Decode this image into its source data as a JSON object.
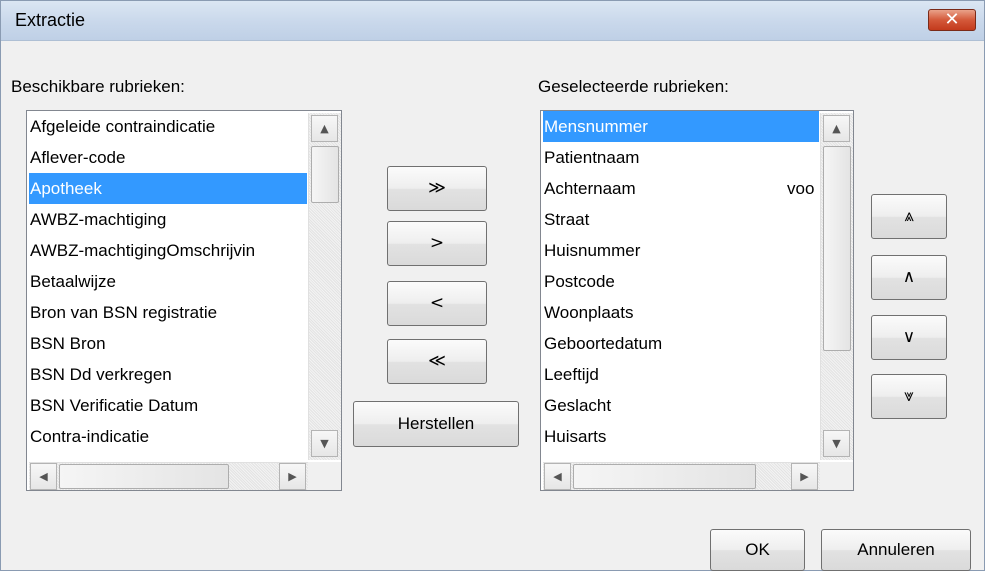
{
  "window": {
    "title": "Extractie",
    "close_glyph": "✕"
  },
  "available": {
    "label": "Beschikbare rubrieken:",
    "items": [
      {
        "label": "Afgeleide contraindicatie"
      },
      {
        "label": "Aflever-code"
      },
      {
        "label": "Apotheek",
        "selected": true
      },
      {
        "label": "AWBZ-machtiging"
      },
      {
        "label": "AWBZ-machtigingOmschrijvin"
      },
      {
        "label": "Betaalwijze"
      },
      {
        "label": "Bron van BSN registratie"
      },
      {
        "label": "BSN Bron"
      },
      {
        "label": "BSN Dd verkregen"
      },
      {
        "label": "BSN Verificatie Datum"
      },
      {
        "label": "Contra-indicatie"
      }
    ]
  },
  "selected": {
    "label": "Geselecteerde rubrieken:",
    "items": [
      {
        "label": "Mensnummer",
        "selected": true
      },
      {
        "label": "Patientnaam"
      },
      {
        "label": "Achternaam",
        "extra": "voo"
      },
      {
        "label": "Straat"
      },
      {
        "label": "Huisnummer"
      },
      {
        "label": "Postcode"
      },
      {
        "label": "Woonplaats"
      },
      {
        "label": "Geboortedatum"
      },
      {
        "label": "Leeftijd"
      },
      {
        "label": "Geslacht"
      },
      {
        "label": "Huisarts"
      }
    ]
  },
  "transfer": {
    "add_all": "≫",
    "add": ">",
    "remove": "<",
    "remove_all": "≪",
    "reset": "Herstellen"
  },
  "order": {
    "top": "⩓",
    "up": "∧",
    "down": "∨",
    "bottom": "⩔"
  },
  "scroll_glyphs": {
    "up": "▲",
    "down": "▼",
    "left": "◀",
    "right": "▶"
  },
  "footer": {
    "ok": "OK",
    "cancel": "Annuleren"
  }
}
